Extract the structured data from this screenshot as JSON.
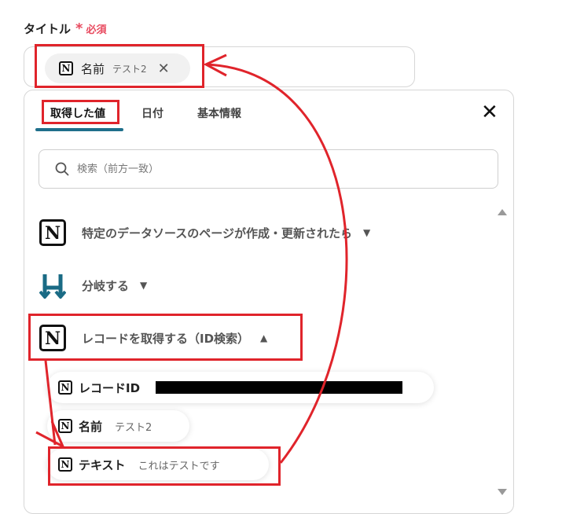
{
  "field": {
    "label": "タイトル",
    "required_mark": "*",
    "required_text": "必須"
  },
  "selected_chip": {
    "icon": "notion-icon",
    "name": "名前",
    "value": "テスト2",
    "remove": "✕"
  },
  "tabs": [
    {
      "label": "取得した値"
    },
    {
      "label": "日付"
    },
    {
      "label": "基本情報"
    }
  ],
  "panel": {
    "close": "✕"
  },
  "search": {
    "placeholder": "検索（前方一致）"
  },
  "sections": [
    {
      "icon": "notion-icon",
      "label": "特定のデータソースのページが作成・更新されたら",
      "chevron": "⌄"
    },
    {
      "icon": "branch-icon",
      "label": "分岐する",
      "chevron": "⌄"
    },
    {
      "icon": "notion-icon",
      "label": "レコードを取得する（ID検索）",
      "chevron": "⌃"
    }
  ],
  "items": [
    {
      "icon": "notion-icon",
      "label": "レコードID",
      "value": ""
    },
    {
      "icon": "notion-icon",
      "label": "名前",
      "value": "テスト2"
    },
    {
      "icon": "notion-icon",
      "label": "テキスト",
      "value": "これはテストです"
    }
  ],
  "colors": {
    "accent": "#1f6f8b",
    "annotation": "#e0242b",
    "required": "#e84a5f"
  },
  "notion_glyph": "N"
}
